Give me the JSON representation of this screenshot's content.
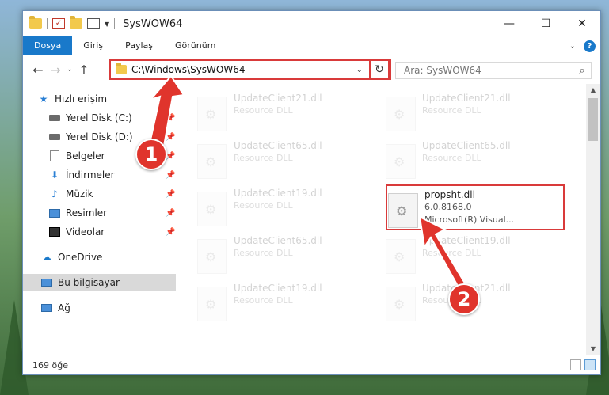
{
  "window": {
    "title": "SysWOW64",
    "minimize": "—",
    "maximize": "☐",
    "close": "✕"
  },
  "ribbon": {
    "tabs": [
      {
        "label": "Dosya",
        "active": true
      },
      {
        "label": "Giriş"
      },
      {
        "label": "Paylaş"
      },
      {
        "label": "Görünüm"
      }
    ],
    "help": "?"
  },
  "navigation": {
    "back": "←",
    "forward": "→",
    "recent": "⌄",
    "up": "↑",
    "address": "C:\\Windows\\SysWOW64",
    "refresh": "↻",
    "search_placeholder": "Ara: SysWOW64"
  },
  "sidebar": {
    "items": [
      {
        "label": "Hızlı erişim",
        "icon": "star-icon"
      },
      {
        "label": "Yerel Disk (C:)",
        "icon": "disk-icon",
        "pinned": true
      },
      {
        "label": "Yerel Disk (D:)",
        "icon": "disk-icon",
        "pinned": true
      },
      {
        "label": "Belgeler",
        "icon": "documents-icon",
        "pinned": true
      },
      {
        "label": "İndirmeler",
        "icon": "download-icon",
        "pinned": true
      },
      {
        "label": "Müzik",
        "icon": "music-icon",
        "pinned": true
      },
      {
        "label": "Resimler",
        "icon": "pictures-icon",
        "pinned": true
      },
      {
        "label": "Videolar",
        "icon": "videos-icon",
        "pinned": true
      },
      {
        "label": "OneDrive",
        "icon": "cloud-icon"
      },
      {
        "label": "Bu bilgisayar",
        "icon": "computer-icon",
        "selected": true
      },
      {
        "label": "Ağ",
        "icon": "network-icon"
      }
    ]
  },
  "files": [
    {
      "name": "UpdateClient21.dll",
      "desc": "Resource DLL"
    },
    {
      "name": "UpdateClient21.dll",
      "desc": "Resource DLL"
    },
    {
      "name": "UpdateClient65.dll",
      "desc": "Resource DLL"
    },
    {
      "name": "UpdateClient65.dll",
      "desc": "Resource DLL"
    },
    {
      "name": "UpdateClient19.dll",
      "desc": "Resource DLL"
    },
    {
      "name": "propsht.dll",
      "version": "6.0.8168.0",
      "desc": "Microsoft(R) Visual..."
    },
    {
      "name": "UpdateClient65.dll",
      "desc": "Resource DLL"
    },
    {
      "name": "UpdateClient19.dll",
      "desc": "Resource DLL"
    },
    {
      "name": "UpdateClient19.dll",
      "desc": "Resource DLL"
    },
    {
      "name": "UpdateClient21.dll",
      "desc": "Resource DLL"
    }
  ],
  "status": {
    "count": "169 öğe"
  },
  "callouts": [
    {
      "label": "1"
    },
    {
      "label": "2"
    }
  ],
  "colors": {
    "accent": "#1979ca",
    "annotation_red": "#e0342c"
  }
}
